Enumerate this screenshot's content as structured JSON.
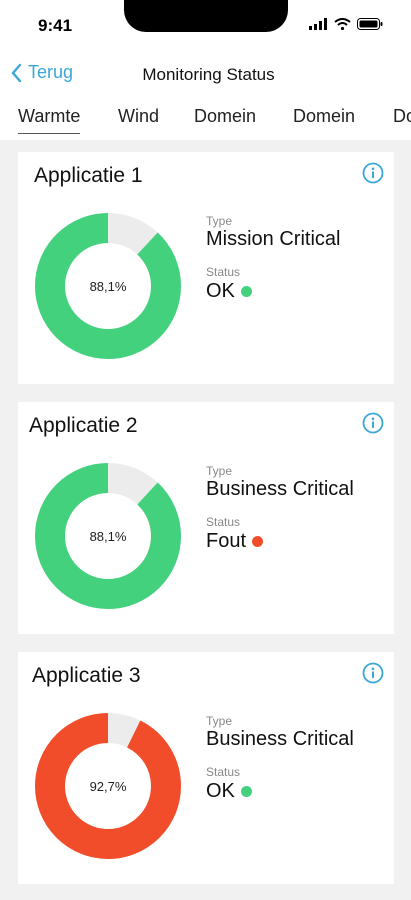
{
  "status_bar": {
    "time": "9:41"
  },
  "nav": {
    "back_label": "Terug",
    "title": "Monitoring Status"
  },
  "tabs": [
    "Warmte",
    "Wind",
    "Domein",
    "Domein",
    "Do"
  ],
  "labels": {
    "type": "Type",
    "status": "Status"
  },
  "colors": {
    "accent": "#3aa7d6",
    "ok": "#44d17e",
    "error": "#f24d2b",
    "ring_bg": "#ececec"
  },
  "cards": [
    {
      "title": "Applicatie 1",
      "type": "Mission Critical",
      "status": "OK",
      "status_color": "#44d17e",
      "percent_label": "88,1%",
      "percent": 88.1,
      "ring_color": "#44d17e"
    },
    {
      "title": "Applicatie 2",
      "type": "Business Critical",
      "status": "Fout",
      "status_color": "#f24d2b",
      "percent_label": "88,1%",
      "percent": 88.1,
      "ring_color": "#44d17e"
    },
    {
      "title": "Applicatie 3",
      "type": "Business Critical",
      "status": "OK",
      "status_color": "#44d17e",
      "percent_label": "92,7%",
      "percent": 92.7,
      "ring_color": "#f24d2b"
    }
  ]
}
